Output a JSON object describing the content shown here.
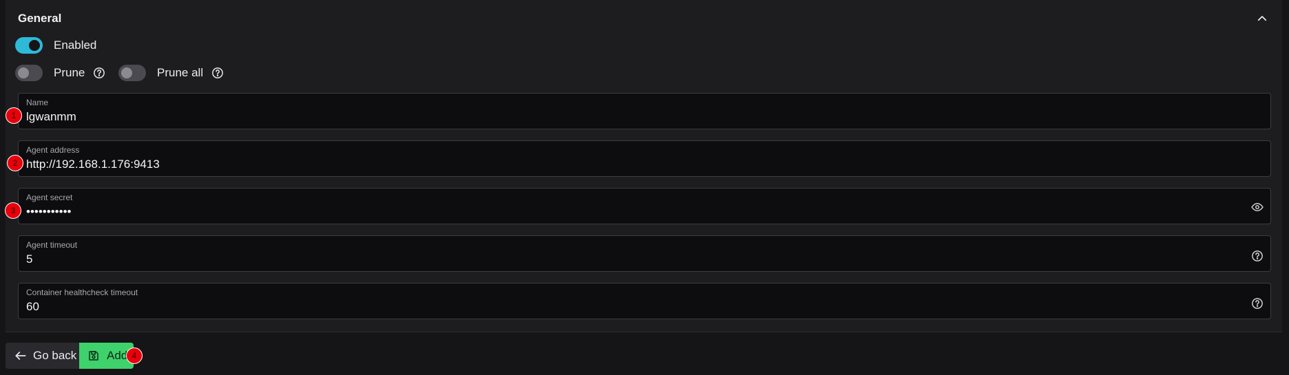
{
  "section": {
    "title": "General"
  },
  "toggles": {
    "enabled": {
      "label": "Enabled",
      "state": "on"
    },
    "prune": {
      "label": "Prune",
      "state": "off"
    },
    "prune_all": {
      "label": "Prune all",
      "state": "off"
    }
  },
  "fields": {
    "name": {
      "label": "Name",
      "value": "lgwanmm",
      "badge": "1"
    },
    "agent_address": {
      "label": "Agent address",
      "value": "http://192.168.1.176:9413",
      "badge": "2"
    },
    "agent_secret": {
      "label": "Agent secret",
      "value": "•••••••••••",
      "badge": "3",
      "icon": "eye-icon"
    },
    "agent_timeout": {
      "label": "Agent timeout",
      "value": "5",
      "icon": "help-circle-icon"
    },
    "container_healthcheck_timeout": {
      "label": "Container healthcheck timeout",
      "value": "60",
      "icon": "help-circle-icon"
    }
  },
  "actions": {
    "back_label": "Go back",
    "add_label": "Add",
    "add_badge": "4"
  },
  "colors": {
    "accent_toggle": "#2fb9d9",
    "add_button": "#3fd16c",
    "badge": "#e8000b",
    "background": "#1d1d20"
  }
}
